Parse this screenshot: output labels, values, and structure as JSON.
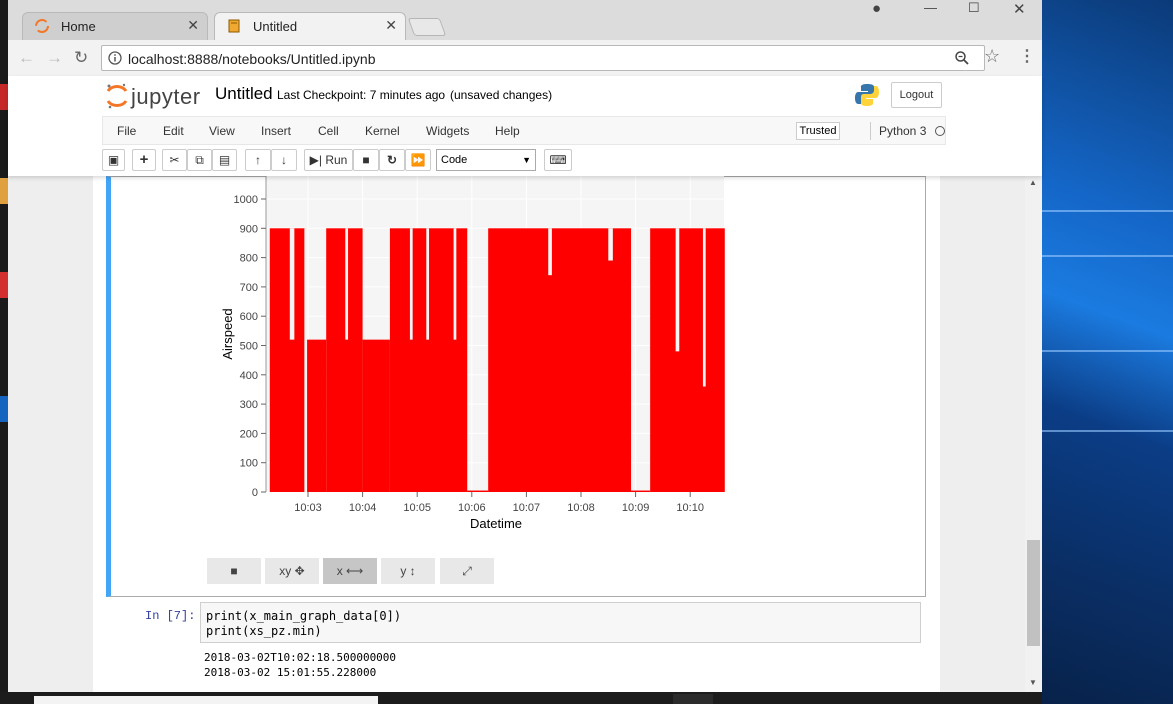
{
  "browser": {
    "tabs": [
      {
        "label": "Home",
        "icon": "jupyter-favicon-icon"
      },
      {
        "label": "Untitled",
        "icon": "notebook-icon"
      }
    ],
    "url": "localhost:8888/notebooks/Untitled.ipynb"
  },
  "jupyter": {
    "logo_text": "jupyter",
    "notebook_name": "Untitled",
    "checkpoint": "Last Checkpoint: 7 minutes ago",
    "save_status": "(unsaved changes)",
    "logout_label": "Logout",
    "menu": [
      "File",
      "Edit",
      "View",
      "Insert",
      "Cell",
      "Kernel",
      "Widgets",
      "Help"
    ],
    "trusted_label": "Trusted",
    "kernel": "Python 3",
    "run_label": "Run",
    "cell_type": "Code"
  },
  "chart_data": {
    "type": "bar",
    "xlabel": "Datetime",
    "ylabel": "Airspeed",
    "ylim": [
      0,
      1000
    ],
    "yticks": [
      0,
      100,
      200,
      300,
      400,
      500,
      600,
      700,
      800,
      900,
      1000
    ],
    "xticks": [
      "10:03",
      "10:04",
      "10:05",
      "10:06",
      "10:07",
      "10:08",
      "10:09",
      "10:10"
    ],
    "color": "#ff0000",
    "background": "#f5f5f5",
    "bands": [
      {
        "start": "10:02:18",
        "end": "10:02:58",
        "value": 900
      },
      {
        "start": "10:02:58",
        "end": "10:03:20",
        "value": 520
      },
      {
        "start": "10:03:20",
        "end": "10:04:00",
        "value": 900
      },
      {
        "start": "10:04:00",
        "end": "10:04:30",
        "value": 520
      },
      {
        "start": "10:04:30",
        "end": "10:05:55",
        "value": 900
      },
      {
        "start": "10:05:55",
        "end": "10:06:18",
        "value": 5
      },
      {
        "start": "10:06:18",
        "end": "10:08:55",
        "value": 900
      },
      {
        "start": "10:08:55",
        "end": "10:09:16",
        "value": 5
      },
      {
        "start": "10:09:16",
        "end": "10:10:38",
        "value": 900
      }
    ],
    "gaps": [
      {
        "start": "10:02:40",
        "end": "10:02:45",
        "value": 520
      },
      {
        "start": "10:02:56",
        "end": "10:02:59",
        "value": 0
      },
      {
        "start": "10:03:41",
        "end": "10:03:44",
        "value": 520
      },
      {
        "start": "10:04:52",
        "end": "10:04:55",
        "value": 520
      },
      {
        "start": "10:05:10",
        "end": "10:05:13",
        "value": 520
      },
      {
        "start": "10:05:40",
        "end": "10:05:43",
        "value": 520
      },
      {
        "start": "10:07:24",
        "end": "10:07:28",
        "value": 740
      },
      {
        "start": "10:08:30",
        "end": "10:08:35",
        "value": 790
      },
      {
        "start": "10:09:44",
        "end": "10:09:48",
        "value": 480
      },
      {
        "start": "10:10:14",
        "end": "10:10:17",
        "value": 360
      }
    ],
    "toolbar": [
      "■",
      "xy ✥",
      "x ⟷",
      "y ↕",
      "⤢"
    ]
  },
  "cell": {
    "prompt": "In [7]:",
    "code": [
      "print(x_main_graph_data[0])",
      "print(xs_pz.min)"
    ],
    "output": [
      "2018-03-02T10:02:18.500000000",
      "2018-03-02 15:01:55.228000"
    ]
  }
}
